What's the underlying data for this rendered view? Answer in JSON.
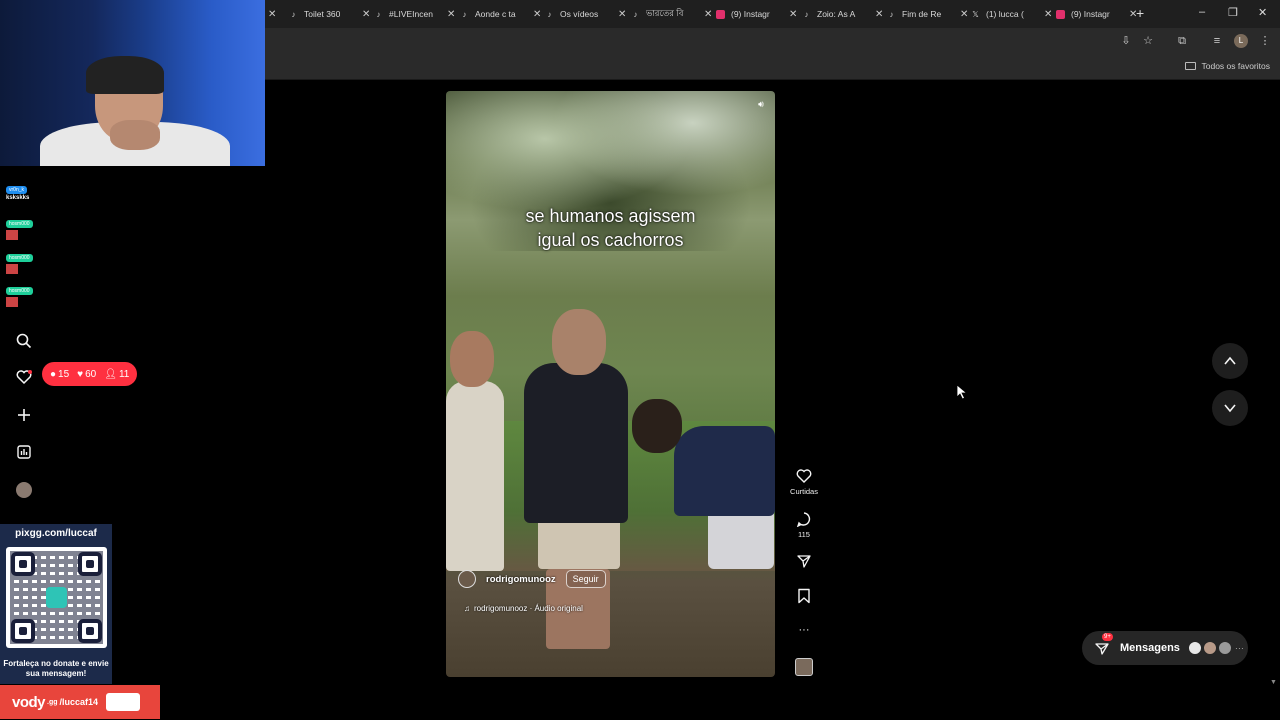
{
  "browser": {
    "tabs": [
      {
        "label": "Toilet 360",
        "icon": "tiktok-icon"
      },
      {
        "label": "#LIVEIncen",
        "icon": "tiktok-icon"
      },
      {
        "label": "Aonde c ta",
        "icon": "tiktok-icon"
      },
      {
        "label": "Os vídeos",
        "icon": "tiktok-icon"
      },
      {
        "label": "ভারতের বি",
        "icon": "tiktok-icon"
      },
      {
        "label": "(9) Instagr",
        "icon": "instagram-icon"
      },
      {
        "label": "Zoio: As A",
        "icon": "tiktok-icon"
      },
      {
        "label": "Fim de Re",
        "icon": "tiktok-icon"
      },
      {
        "label": "(1) lucca (",
        "icon": "x-icon"
      },
      {
        "label": "(9) Instagr",
        "icon": "instagram-icon"
      }
    ],
    "new_tab": "+",
    "window_controls": {
      "minimize": "–",
      "restore": "❐",
      "close": "✕"
    },
    "profile_initial": "L",
    "bookmarks_all": "Todos os favoritos"
  },
  "stream": {
    "chat": [
      {
        "tag": "vr0n_k",
        "text": "kskskks"
      },
      {
        "tag": "hosm000",
        "text": ""
      },
      {
        "tag": "hosm000",
        "text": ""
      },
      {
        "tag": "hosm000",
        "text": ""
      }
    ],
    "pix": {
      "url": "pixgg.com/luccaf",
      "message": "Fortaleça no donate e envie sua mensagem!"
    },
    "vody": {
      "logo": "vody",
      "suffix": ".gg",
      "user": "/luccaf14"
    }
  },
  "instagram": {
    "notifications": {
      "comments": "15",
      "likes": "60",
      "follows": "11"
    },
    "reel": {
      "caption_line1": "se humanos agissem",
      "caption_line2": "igual os cachorros",
      "username": "rodrigomunooz",
      "follow_label": "Seguir",
      "audio": "rodrigomunooz · Áudio original"
    },
    "actions": {
      "likes_label": "Curtidas",
      "comments_count": "115",
      "more": "···"
    },
    "messages": {
      "label": "Mensagens",
      "badge": "9+"
    },
    "colors": {
      "accent_red": "#ff3040",
      "background": "#000000"
    }
  }
}
